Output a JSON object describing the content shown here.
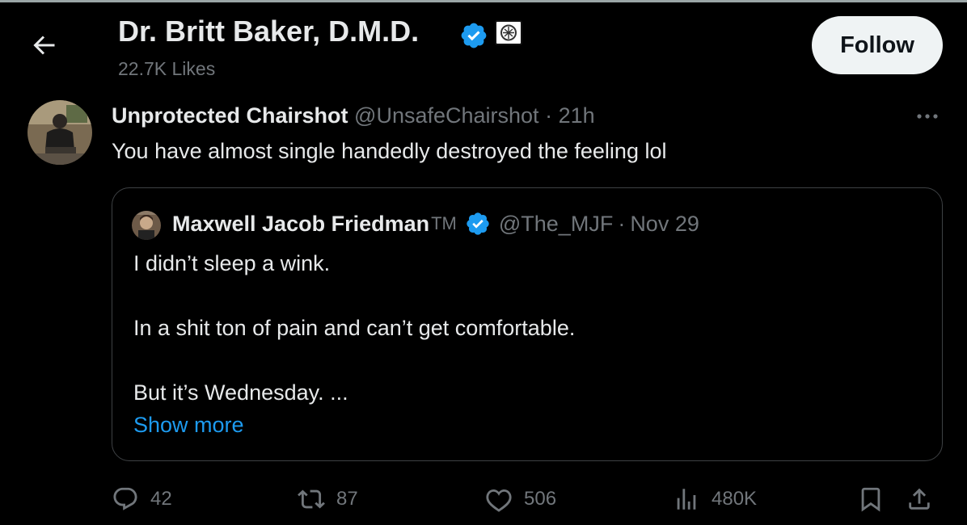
{
  "header": {
    "back_icon": "arrow-left-icon",
    "profile_name": "Dr. Britt Baker, D.M.D.",
    "likes": "22.7K Likes",
    "follow_label": "Follow",
    "verified_color": "#1d9bf0"
  },
  "tweet": {
    "author_name": "Unprotected Chairshot",
    "author_handle": "@UnsafeChairshot",
    "separator": "·",
    "time": "21h",
    "text": "You have almost single handedly destroyed the feeling lol",
    "more_icon": "more-horizontal-icon"
  },
  "quote": {
    "name": "Maxwell Jacob Friedman",
    "tm": "TM",
    "handle": "@The_MJF",
    "separator": "·",
    "date": "Nov 29",
    "line1": "I didn’t sleep a wink.",
    "line2": "In a shit ton of pain and can’t get comfortable.",
    "line3": "But it’s Wednesday. ...",
    "show_more": "Show more"
  },
  "actions": {
    "replies": "42",
    "reposts": "87",
    "likes": "506",
    "views": "480K"
  },
  "colors": {
    "background": "#000000",
    "text": "#e7e9ea",
    "muted": "#71767b",
    "accent": "#1d9bf0",
    "border": "#3e4144"
  }
}
